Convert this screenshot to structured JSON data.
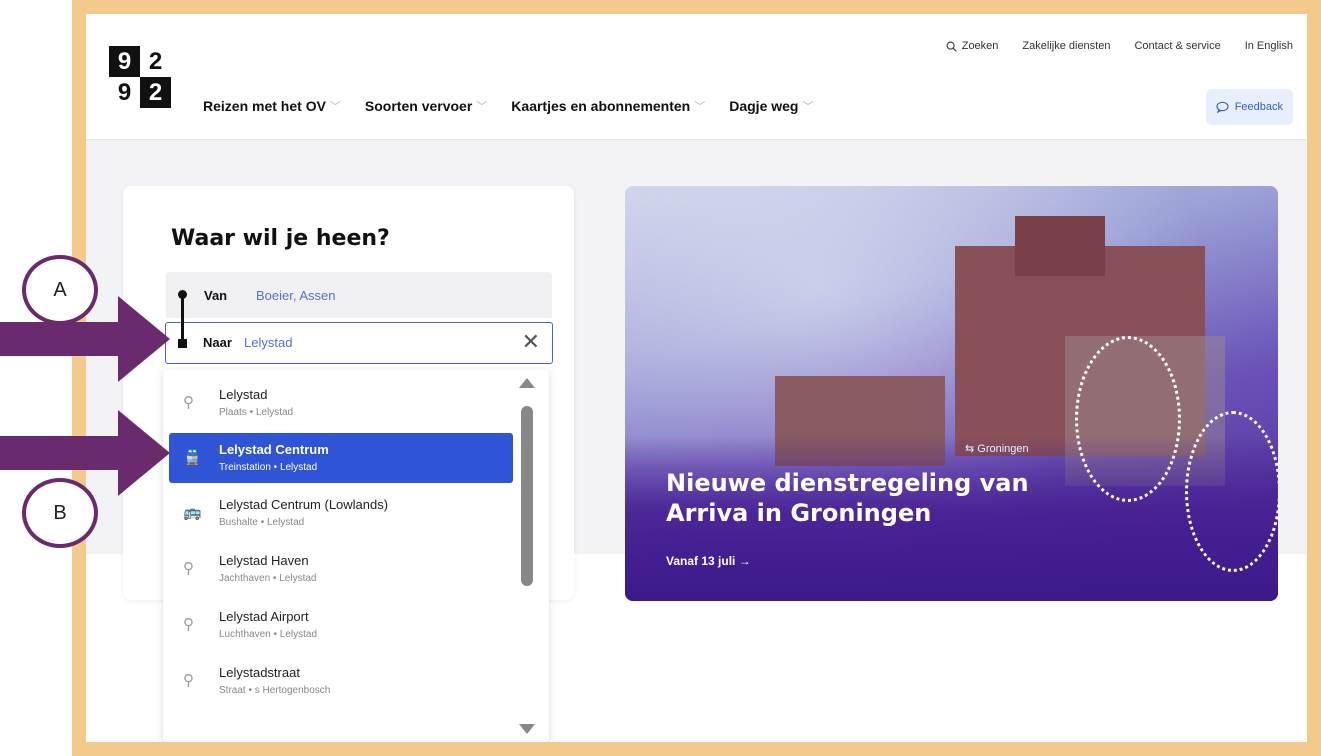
{
  "logo": {
    "digits": [
      "9",
      "2",
      "9",
      "2"
    ]
  },
  "toplinks": {
    "search": "Zoeken",
    "business": "Zakelijke diensten",
    "contact": "Contact & service",
    "english": "In English"
  },
  "nav": [
    {
      "label": "Reizen met het OV"
    },
    {
      "label": "Soorten vervoer"
    },
    {
      "label": "Kaartjes en abonnementen"
    },
    {
      "label": "Dagje weg"
    }
  ],
  "feedback": {
    "label": "Feedback"
  },
  "planner": {
    "title": "Waar wil je heen?",
    "from_label": "Van",
    "from_value": "Boeier, Assen",
    "to_label": "Naar",
    "to_value": "Lelystad",
    "clear_symbol": "✕"
  },
  "suggestions": [
    {
      "title": "Lelystad",
      "type": "Plaats",
      "place": "Lelystad",
      "icon": "location-pin-icon",
      "selected": false
    },
    {
      "title": "Lelystad Centrum",
      "type": "Treinstation",
      "place": "Lelystad",
      "icon": "train-icon",
      "selected": true
    },
    {
      "title": "Lelystad Centrum (Lowlands)",
      "type": "Bushalte",
      "place": "Lelystad",
      "icon": "bus-icon",
      "selected": false
    },
    {
      "title": "Lelystad Haven",
      "type": "Jachthaven",
      "place": "Lelystad",
      "icon": "location-pin-icon",
      "selected": false
    },
    {
      "title": "Lelystad Airport",
      "type": "Luchthaven",
      "place": "Lelystad",
      "icon": "location-pin-icon",
      "selected": false
    },
    {
      "title": "Lelystadstraat",
      "type": "Straat",
      "place": "s Hertogenbosch",
      "icon": "location-pin-icon",
      "selected": false
    }
  ],
  "banner": {
    "title": "Nieuwe dienstregeling van Arriva in Groningen",
    "link": "Vanaf 13 juli →",
    "station_sign": "Groningen"
  },
  "annotations": {
    "a": "A",
    "b": "B"
  },
  "colors": {
    "frame": "#f3c98c",
    "accent": "#2f54d6",
    "annotation": "#6a2a6e"
  }
}
